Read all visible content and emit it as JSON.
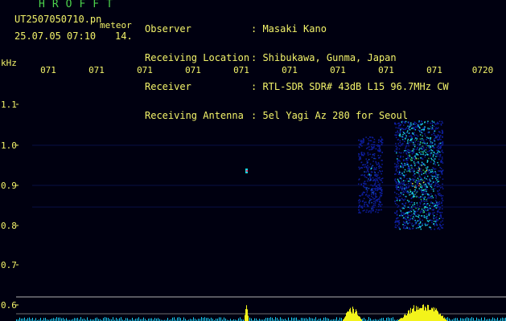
{
  "header": {
    "brand": "HROFFT",
    "filename": "UT2507050710.pn",
    "mode": "meteor",
    "timestamp": "25.07.05 07:10",
    "frame": "14.",
    "meta_labels": [
      "Observer",
      "Receiving Location",
      "Receiver",
      "Receiving Antenna"
    ],
    "meta_values": [
      ": Masaki Kano",
      ": Shibukawa, Gunma, Japan",
      ": RTL-SDR SDR# 43dB L15 96.7MHz CW",
      ": 5el Yagi Az 280 for Seoul"
    ]
  },
  "axes": {
    "y_unit": "kHz",
    "y_ticks": [
      "1.1",
      "1.0",
      "0.9",
      "0.8",
      "0.7",
      "0.6"
    ],
    "x_ticks": [
      "071",
      "071",
      "071",
      "071",
      "071",
      "071",
      "071",
      "071",
      "071",
      "0720"
    ]
  },
  "colors": {
    "label_text": "#f3f36a",
    "brand_text": "#4cd34c",
    "background": "#000010",
    "spectrum_low": "#0e1ea0",
    "spectrum_mid": "#1ad0e0",
    "spectrum_high": "#e23b6a",
    "amplitude_trace": "#f3f31a",
    "noise_trace": "#19d6ff"
  },
  "spectrogram": {
    "events": [
      {
        "minute_index": 7,
        "kHz_low": 0.83,
        "kHz_high": 1.02,
        "intensity": "medium"
      },
      {
        "minute_index": 8,
        "kHz_low": 0.79,
        "kHz_high": 1.06,
        "intensity": "high"
      },
      {
        "minute_index": 4,
        "kHz_low": 0.92,
        "kHz_high": 0.94,
        "intensity": "spot"
      }
    ]
  }
}
